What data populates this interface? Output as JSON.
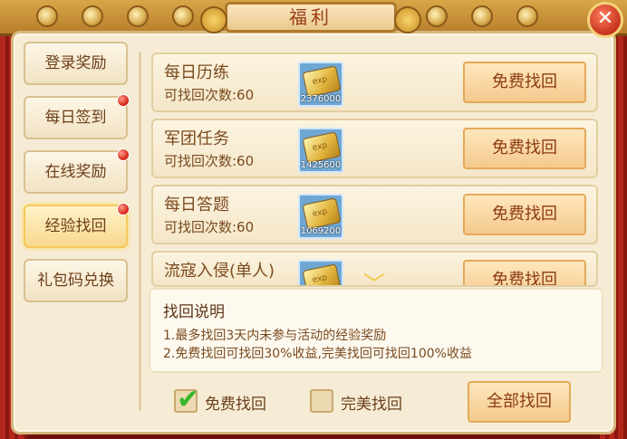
{
  "window": {
    "title": "福利",
    "close_glyph": "✕"
  },
  "sidebar": {
    "items": [
      {
        "label": "登录奖励",
        "has_badge": false,
        "active": false
      },
      {
        "label": "每日签到",
        "has_badge": true,
        "active": false
      },
      {
        "label": "在线奖励",
        "has_badge": true,
        "active": false
      },
      {
        "label": "经验找回",
        "has_badge": true,
        "active": true
      },
      {
        "label": "礼包码兑换",
        "has_badge": false,
        "active": false
      }
    ]
  },
  "rows": [
    {
      "name": "每日历练",
      "count": "可找回次数:60",
      "reward_amount": "2376000",
      "reward_icon": "exp-ticket-icon",
      "button": "免费找回"
    },
    {
      "name": "军团任务",
      "count": "可找回次数:60",
      "reward_amount": "1425600",
      "reward_icon": "exp-ticket-icon",
      "button": "免费找回"
    },
    {
      "name": "每日答题",
      "count": "可找回次数:60",
      "reward_amount": "1069200",
      "reward_icon": "exp-ticket-icon",
      "button": "免费找回"
    },
    {
      "name": "流寇入侵(单人)",
      "count": "",
      "reward_amount": "",
      "reward_icon": "exp-ticket-icon",
      "button": "免费找回"
    }
  ],
  "explanation": {
    "title": "找回说明",
    "lines": [
      "1.最多找回3天内未参与活动的经验奖励",
      "2.免费找回可找回30%收益,完美找回可找回100%收益"
    ]
  },
  "options": {
    "free": {
      "label": "免费找回",
      "checked": true
    },
    "perfect": {
      "label": "完美找回",
      "checked": false
    }
  },
  "all_button": {
    "label": "全部找回"
  },
  "colors": {
    "accent": "#f4c98d",
    "text_brown": "#7a4a1e",
    "badge_red": "#d41e12",
    "check_green": "#38b62c"
  }
}
